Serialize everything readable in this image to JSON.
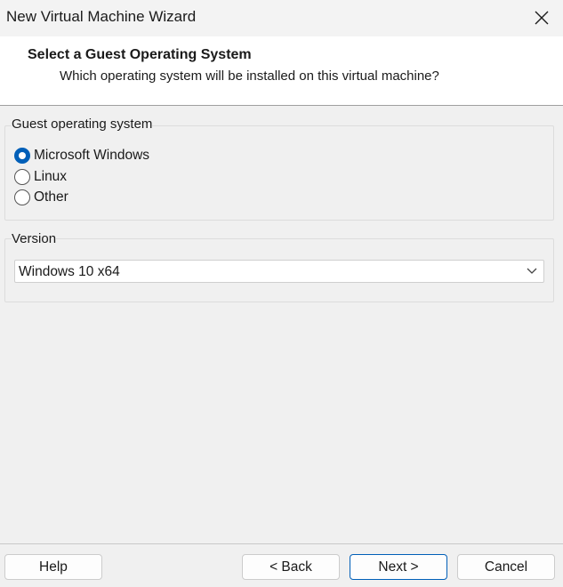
{
  "window": {
    "title": "New Virtual Machine Wizard"
  },
  "header": {
    "title": "Select a Guest Operating System",
    "subtitle": "Which operating system will be installed on this virtual machine?"
  },
  "guest_os": {
    "legend": "Guest operating system",
    "options": [
      {
        "label": "Microsoft Windows",
        "selected": true
      },
      {
        "label": "Linux",
        "selected": false
      },
      {
        "label": "Other",
        "selected": false
      }
    ]
  },
  "version": {
    "legend": "Version",
    "selected": "Windows 10 x64"
  },
  "buttons": {
    "help": "Help",
    "back": "< Back",
    "next": "Next >",
    "cancel": "Cancel"
  },
  "colors": {
    "accent": "#005fb8",
    "background": "#f0f0f0"
  }
}
